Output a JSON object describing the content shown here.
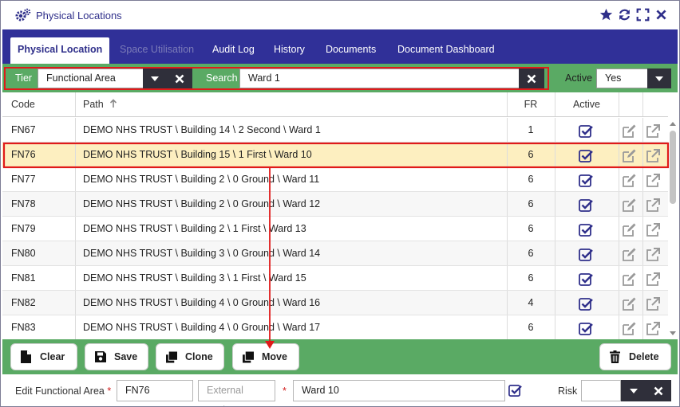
{
  "window": {
    "title": "Physical Locations"
  },
  "tabs": [
    {
      "label": "Physical Location",
      "state": "active"
    },
    {
      "label": "Space Utilisation",
      "state": "disabled"
    },
    {
      "label": "Audit Log",
      "state": "normal"
    },
    {
      "label": "History",
      "state": "normal"
    },
    {
      "label": "Documents",
      "state": "normal"
    },
    {
      "label": "Document Dashboard",
      "state": "normal"
    }
  ],
  "filter": {
    "tier_label": "Tier",
    "tier_value": "Functional Area",
    "search_label": "Search",
    "search_value": "Ward 1",
    "active_label": "Active",
    "active_value": "Yes"
  },
  "table": {
    "headers": {
      "code": "Code",
      "path": "Path",
      "fr": "FR",
      "active": "Active"
    },
    "sort": {
      "column": "path",
      "direction": "ascending"
    },
    "selected_row": 1,
    "rows": [
      {
        "code": "FN67",
        "path": "DEMO NHS TRUST \\ Building 14 \\ 2 Second \\ Ward 1",
        "fr": "1",
        "active": true
      },
      {
        "code": "FN76",
        "path": "DEMO NHS TRUST \\ Building 15 \\ 1 First \\ Ward 10",
        "fr": "6",
        "active": true
      },
      {
        "code": "FN77",
        "path": "DEMO NHS TRUST \\ Building 2 \\ 0 Ground \\ Ward 11",
        "fr": "6",
        "active": true
      },
      {
        "code": "FN78",
        "path": "DEMO NHS TRUST \\ Building 2 \\ 0 Ground \\ Ward 12",
        "fr": "6",
        "active": true
      },
      {
        "code": "FN79",
        "path": "DEMO NHS TRUST \\ Building 2 \\ 1 First \\ Ward 13",
        "fr": "6",
        "active": true
      },
      {
        "code": "FN80",
        "path": "DEMO NHS TRUST \\ Building 3 \\ 0 Ground \\ Ward 14",
        "fr": "6",
        "active": true
      },
      {
        "code": "FN81",
        "path": "DEMO NHS TRUST \\ Building 3 \\ 1 First \\ Ward 15",
        "fr": "6",
        "active": true
      },
      {
        "code": "FN82",
        "path": "DEMO NHS TRUST \\ Building 4 \\ 0 Ground \\ Ward 16",
        "fr": "4",
        "active": true
      },
      {
        "code": "FN83",
        "path": "DEMO NHS TRUST \\ Building 4 \\ 0 Ground \\ Ward 17",
        "fr": "6",
        "active": true
      }
    ]
  },
  "actions": {
    "clear": "Clear",
    "save": "Save",
    "clone": "Clone",
    "move": "Move",
    "delete": "Delete"
  },
  "edit": {
    "label": "Edit Functional Area",
    "code_value": "FN76",
    "external_placeholder": "External Code",
    "name_value": "Ward 10",
    "name_checked": true,
    "risk_label": "Risk",
    "risk_value": ""
  },
  "colors": {
    "accent": "#303098",
    "green_bar": "#5aaa64",
    "highlight": "#e01a1a",
    "selected_row": "#fdefc0",
    "check": "#2f2f8a"
  }
}
